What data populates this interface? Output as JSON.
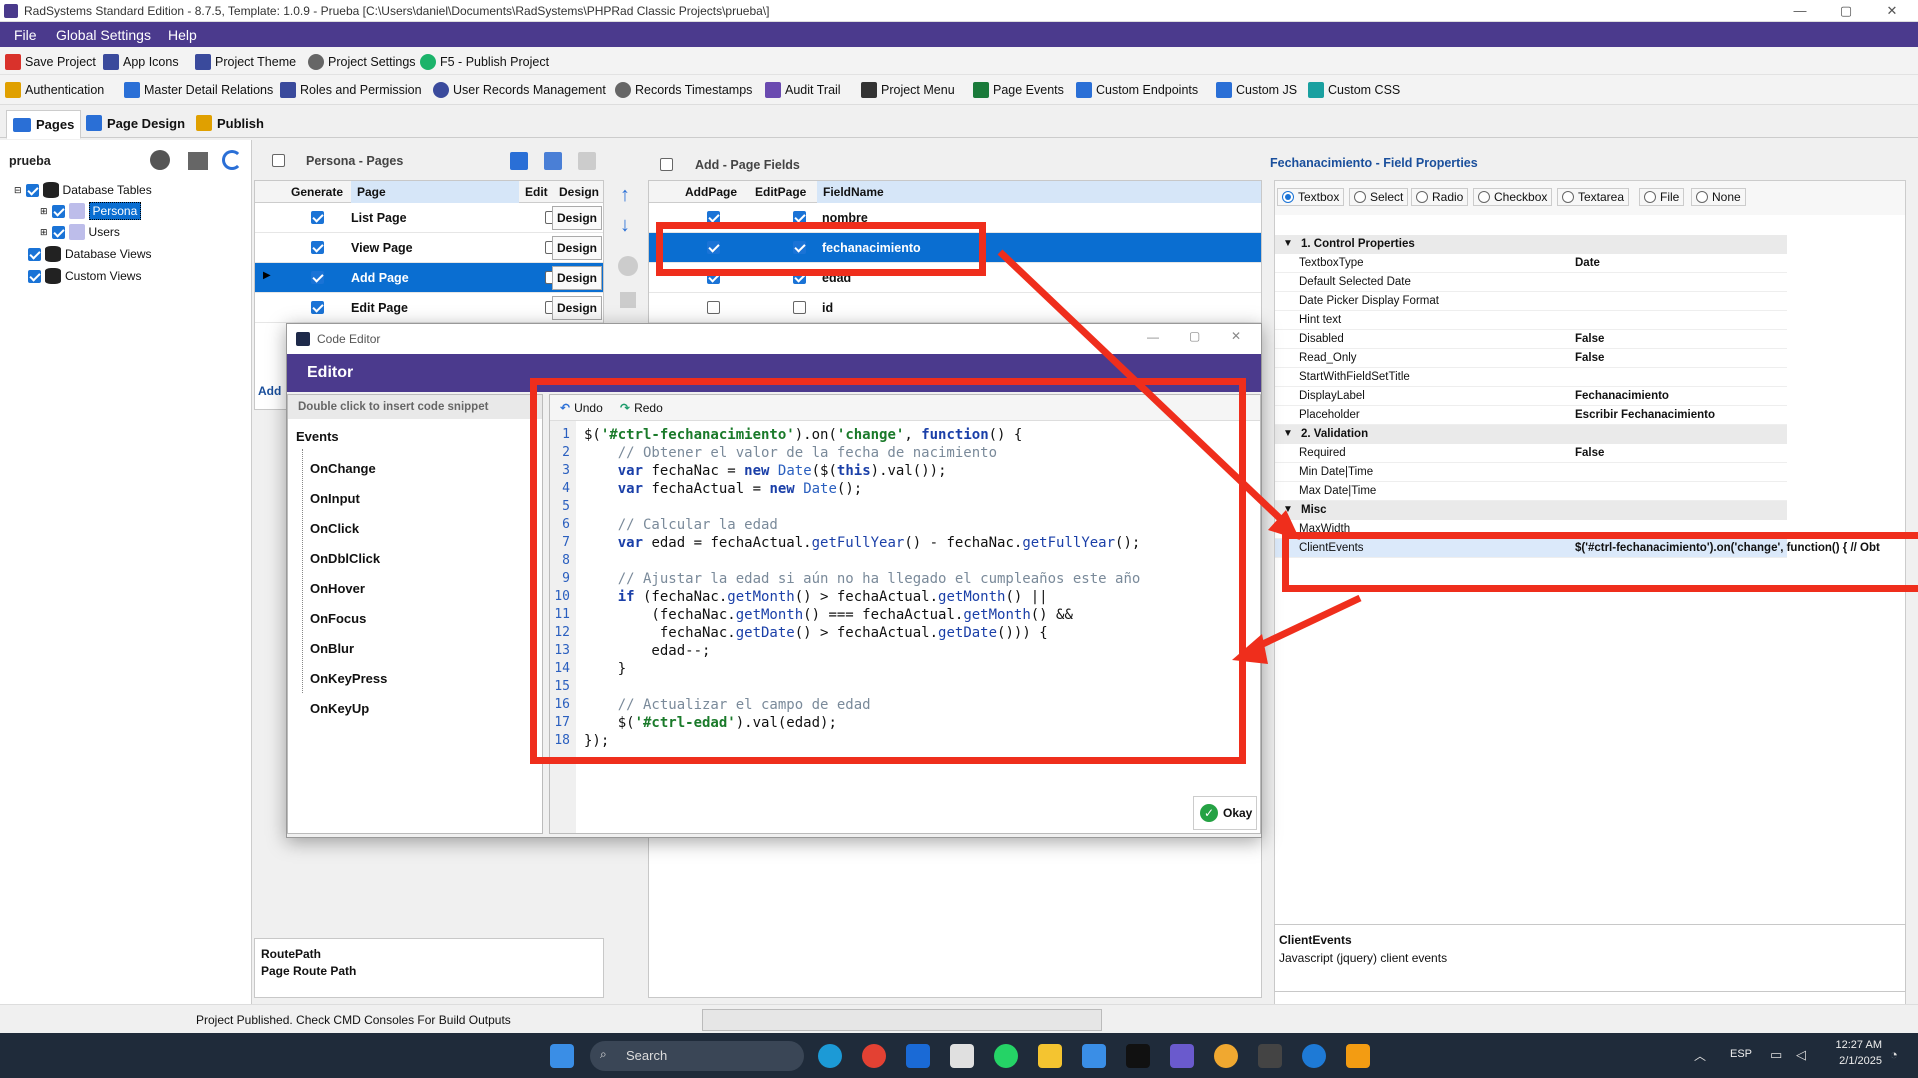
{
  "window": {
    "title": "RadSystems Standard Edition - 8.7.5, Template: 1.0.9 - Prueba [C:\\Users\\daniel\\Documents\\RadSystems\\PHPRad Classic Projects\\prueba\\]"
  },
  "menu": [
    "File",
    "Global Settings",
    "Help"
  ],
  "toolbar1": [
    {
      "label": "Save Project",
      "icon": "save-icon",
      "color": "#d9322b"
    },
    {
      "label": "App Icons",
      "icon": "app-icons-icon",
      "color": "#3a4a9c"
    },
    {
      "label": "Project Theme",
      "icon": "theme-icon",
      "color": "#3a4a9c"
    },
    {
      "label": "Project Settings",
      "icon": "gear-icon",
      "color": "#555555"
    },
    {
      "label": "F5 - Publish Project",
      "icon": "play-icon",
      "color": "#1bb36a"
    }
  ],
  "toolbar2": [
    {
      "label": "Authentication",
      "icon": "lock-icon",
      "color": "#e0a000"
    },
    {
      "label": "Master Detail Relations",
      "icon": "table-icon",
      "color": "#2a6fd6"
    },
    {
      "label": "Roles and Permission",
      "icon": "roles-icon",
      "color": "#3a4a9c"
    },
    {
      "label": "User Records Management",
      "icon": "user-icon",
      "color": "#3a4a9c"
    },
    {
      "label": "Records Timestamps",
      "icon": "gear-icon",
      "color": "#555555"
    },
    {
      "label": "Audit Trail",
      "icon": "audit-icon",
      "color": "#6a4ab0"
    },
    {
      "label": "Project Menu",
      "icon": "menu-icon",
      "color": "#333333"
    },
    {
      "label": "Page Events",
      "icon": "events-icon",
      "color": "#1a7a3a"
    },
    {
      "label": "Custom Endpoints",
      "icon": "endpoints-icon",
      "color": "#2a6fd6"
    },
    {
      "label": "Custom JS",
      "icon": "js-icon",
      "color": "#2a6fd6"
    },
    {
      "label": "Custom CSS",
      "icon": "css-icon",
      "color": "#1aa0a0"
    }
  ],
  "tabs": [
    "Pages",
    "Page Design",
    "Publish"
  ],
  "project": {
    "name": "prueba",
    "tree": {
      "database_tables": "Database Tables",
      "tables": [
        "Persona",
        "Users"
      ],
      "database_views": "Database Views",
      "custom_views": "Custom Views"
    }
  },
  "pages_panel": {
    "title": "Persona - Pages",
    "headers": [
      "Generate",
      "Page",
      "Edit",
      "Design"
    ],
    "rows": [
      {
        "page": "List Page",
        "generate": true,
        "edit": false,
        "design": "Design"
      },
      {
        "page": "View Page",
        "generate": true,
        "edit": false,
        "design": "Design"
      },
      {
        "page": "Add Page",
        "generate": true,
        "edit": false,
        "design": "Design",
        "selected": true
      },
      {
        "page": "Edit Page",
        "generate": true,
        "edit": false,
        "design": "Design"
      }
    ],
    "add_label": "Add",
    "route_path_title": "RoutePath",
    "route_path_desc": "Page Route Path"
  },
  "fields_panel": {
    "title": "Add - Page Fields",
    "headers": [
      "AddPage",
      "EditPage",
      "FieldName"
    ],
    "rows": [
      {
        "name": "nombre",
        "add": true,
        "edit": true
      },
      {
        "name": "fechanacimiento",
        "add": true,
        "edit": true,
        "selected": true
      },
      {
        "name": "edad",
        "add": true,
        "edit": true
      },
      {
        "name": "id",
        "add": false,
        "edit": false
      }
    ]
  },
  "props_panel": {
    "title": "Fechanacimiento - Field Properties",
    "control_types": [
      "Textbox",
      "Select",
      "Radio",
      "Checkbox",
      "Textarea",
      "File",
      "None"
    ],
    "selected_control": "Textbox",
    "cat1": "1. Control Properties",
    "props1": [
      {
        "k": "TextboxType",
        "v": "Date"
      },
      {
        "k": "Default Selected Date",
        "v": ""
      },
      {
        "k": "Date Picker Display Format",
        "v": ""
      },
      {
        "k": "Hint text",
        "v": ""
      },
      {
        "k": "Disabled",
        "v": "False"
      },
      {
        "k": "Read_Only",
        "v": "False"
      },
      {
        "k": "StartWithFieldSetTitle",
        "v": ""
      },
      {
        "k": "DisplayLabel",
        "v": "Fechanacimiento"
      },
      {
        "k": "Placeholder",
        "v": "Escribir Fechanacimiento"
      }
    ],
    "cat2": "2. Validation",
    "props2": [
      {
        "k": "Required",
        "v": "False"
      },
      {
        "k": "Min Date|Time",
        "v": ""
      },
      {
        "k": "Max Date|Time",
        "v": ""
      }
    ],
    "cat3": "Misc",
    "props3": [
      {
        "k": "MaxWidth",
        "v": ""
      },
      {
        "k": "ClientEvents",
        "v": "$('#ctrl-fechanacimiento').on('change', function() {    // Obt"
      }
    ],
    "desc_title": "ClientEvents",
    "desc_text": "Javascript (jquery) client events"
  },
  "code_editor": {
    "window_title": "Code Editor",
    "header": "Editor",
    "snippet_hint": "Double click to insert code snippet",
    "events_root": "Events",
    "events": [
      "OnChange",
      "OnInput",
      "OnClick",
      "OnDblClick",
      "OnHover",
      "OnFocus",
      "OnBlur",
      "OnKeyPress",
      "OnKeyUp"
    ],
    "undo": "Undo",
    "redo": "Redo",
    "okay": "Okay",
    "lines": [
      "$('#ctrl-fechanacimiento').on('change', function() {",
      "    // Obtener el valor de la fecha de nacimiento",
      "    var fechaNac = new Date($(this).val());",
      "    var fechaActual = new Date();",
      "",
      "    // Calcular la edad",
      "    var edad = fechaActual.getFullYear() - fechaNac.getFullYear();",
      "",
      "    // Ajustar la edad si aún no ha llegado el cumpleaños este año",
      "    if (fechaNac.getMonth() > fechaActual.getMonth() ||",
      "        (fechaNac.getMonth() === fechaActual.getMonth() &&",
      "         fechaNac.getDate() > fechaActual.getDate())) {",
      "        edad--;",
      "    }",
      "",
      "    // Actualizar el campo de edad",
      "    $('#ctrl-edad').val(edad);",
      "});"
    ]
  },
  "status": {
    "text": "Project Published. Check CMD Consoles For Build Outputs"
  },
  "taskbar": {
    "search": "Search",
    "lang": "ESP",
    "time": "12:27 AM",
    "date": "2/1/2025"
  },
  "colors": {
    "accent": "#4b3a8d",
    "selection": "#0a6ed1",
    "annotation": "#ef2e1c"
  }
}
